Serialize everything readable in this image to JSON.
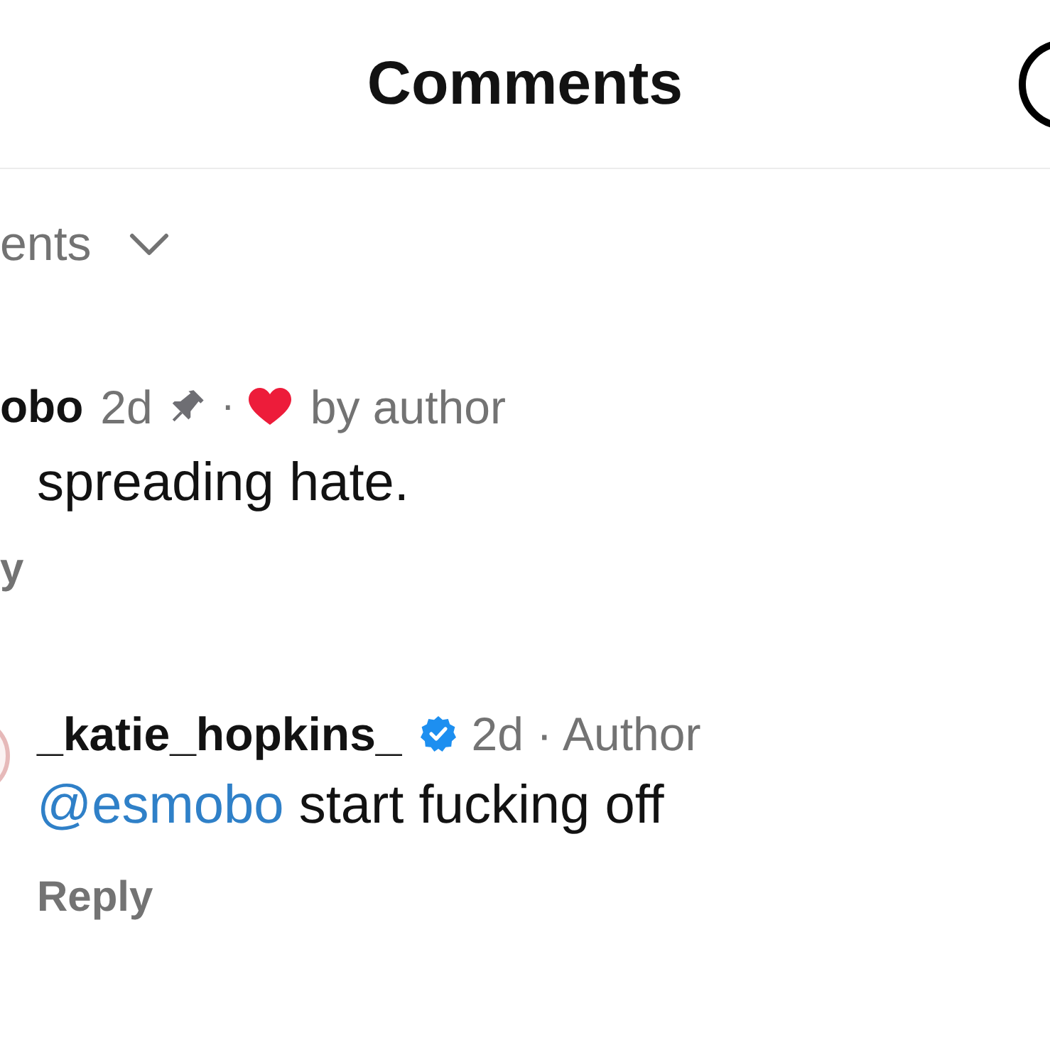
{
  "header": {
    "title": "Comments"
  },
  "sort": {
    "label": "ents"
  },
  "comments": [
    {
      "username": "obo",
      "time": "2d",
      "pinned": true,
      "separator": "·",
      "liked_by_author": true,
      "liked_label": "by author",
      "text": "spreading hate.",
      "reply_label": "y",
      "replies": [
        {
          "username": "_katie_hopkins_",
          "verified": true,
          "meta": "2d · Author",
          "mention": "@esmobo",
          "text": "start fucking off",
          "reply_label": "Reply"
        }
      ]
    }
  ]
}
